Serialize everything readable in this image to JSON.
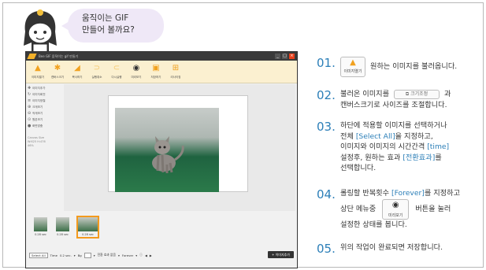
{
  "header": {
    "speech": [
      "움직이는 GIF",
      "만들어 볼까요?"
    ]
  },
  "app": {
    "title": "Bee GIF  움직이는 gif 만들기",
    "window_buttons": [
      "_",
      "□",
      "×"
    ],
    "toolbar": [
      {
        "label": "이미지열기",
        "icon": "folder-open-icon",
        "dim": false
      },
      {
        "label": "캔버스크기",
        "icon": "canvas-size-icon",
        "dim": false
      },
      {
        "label": "복사하기",
        "icon": "copy-icon",
        "dim": false
      },
      {
        "label": "실행취소",
        "icon": "undo-icon",
        "dim": true
      },
      {
        "label": "다시실행",
        "icon": "redo-icon",
        "dim": true
      },
      {
        "label": "미리보기",
        "icon": "preview-eye-icon",
        "dim": false
      },
      {
        "label": "저장하기",
        "icon": "save-icon",
        "dim": false
      },
      {
        "label": "리사이징",
        "icon": "resize-icon",
        "dim": false
      }
    ],
    "side_tools": [
      {
        "label": "이미지추가",
        "icon": "add-image-icon"
      },
      {
        "label": "이미지회전",
        "icon": "rotate-icon"
      },
      {
        "label": "이미지정렬",
        "icon": "sort-icon"
      },
      {
        "label": "크게보기",
        "icon": "zoom-in-icon"
      },
      {
        "label": "작게보기",
        "icon": "zoom-out-icon"
      },
      {
        "label": "원본보기",
        "icon": "original-size-icon"
      },
      {
        "label": "화면맞춤",
        "icon": "fit-screen-icon"
      }
    ],
    "canvas_size": {
      "label": "Canvas Size",
      "w": "W:625",
      "h": "H:476",
      "zoom": "46%"
    },
    "thumbnails": [
      {
        "time": "0.28 sec",
        "selected": false
      },
      {
        "time": "0.28 sec",
        "selected": false
      },
      {
        "time": "0.28 sec",
        "selected": true
      }
    ],
    "bottom": {
      "select_all": "Select All",
      "time_label": "Time",
      "time_value": "0.2 sec.",
      "bg_label": "Bg",
      "effect": "전환 효과 없음",
      "forever": "Forever",
      "add_button": "+ 이미지추가"
    }
  },
  "steps": [
    {
      "num": "01.",
      "lines": [
        "원하는 이미지를 불러옵니다."
      ],
      "icon_label": "이미지열기"
    },
    {
      "num": "02.",
      "lines": [
        "불러온 이미지를",
        "과",
        "캔버스크기로 사이즈를 조절합니다."
      ],
      "icon_label": "크기조정"
    },
    {
      "num": "03.",
      "lines": [
        "하단에 적용할 이미지를 선택하거나",
        "전체 ",
        "[Select All]",
        "을 지정하고,",
        "이미지와 이미지의 시간간격 ",
        "[time]",
        "설정후, 원하는 효과 ",
        "[전환효과]",
        "를",
        "선택합니다."
      ]
    },
    {
      "num": "04.",
      "lines": [
        "롤링할 반복횟수 ",
        "[Forever]",
        "를 지정하고",
        "상단 메뉴중",
        "버튼을 눌러",
        "설정한 상태를 봅니다."
      ],
      "icon_label": "미리보기"
    },
    {
      "num": "05.",
      "lines": [
        "위의 작업이 완료되면 저장합니다."
      ]
    }
  ],
  "colors": {
    "accent": "#2c7fb8",
    "toolbar_bg": "#fbf0d0",
    "icon": "#f1a11f",
    "selected": "#f39a1e"
  }
}
